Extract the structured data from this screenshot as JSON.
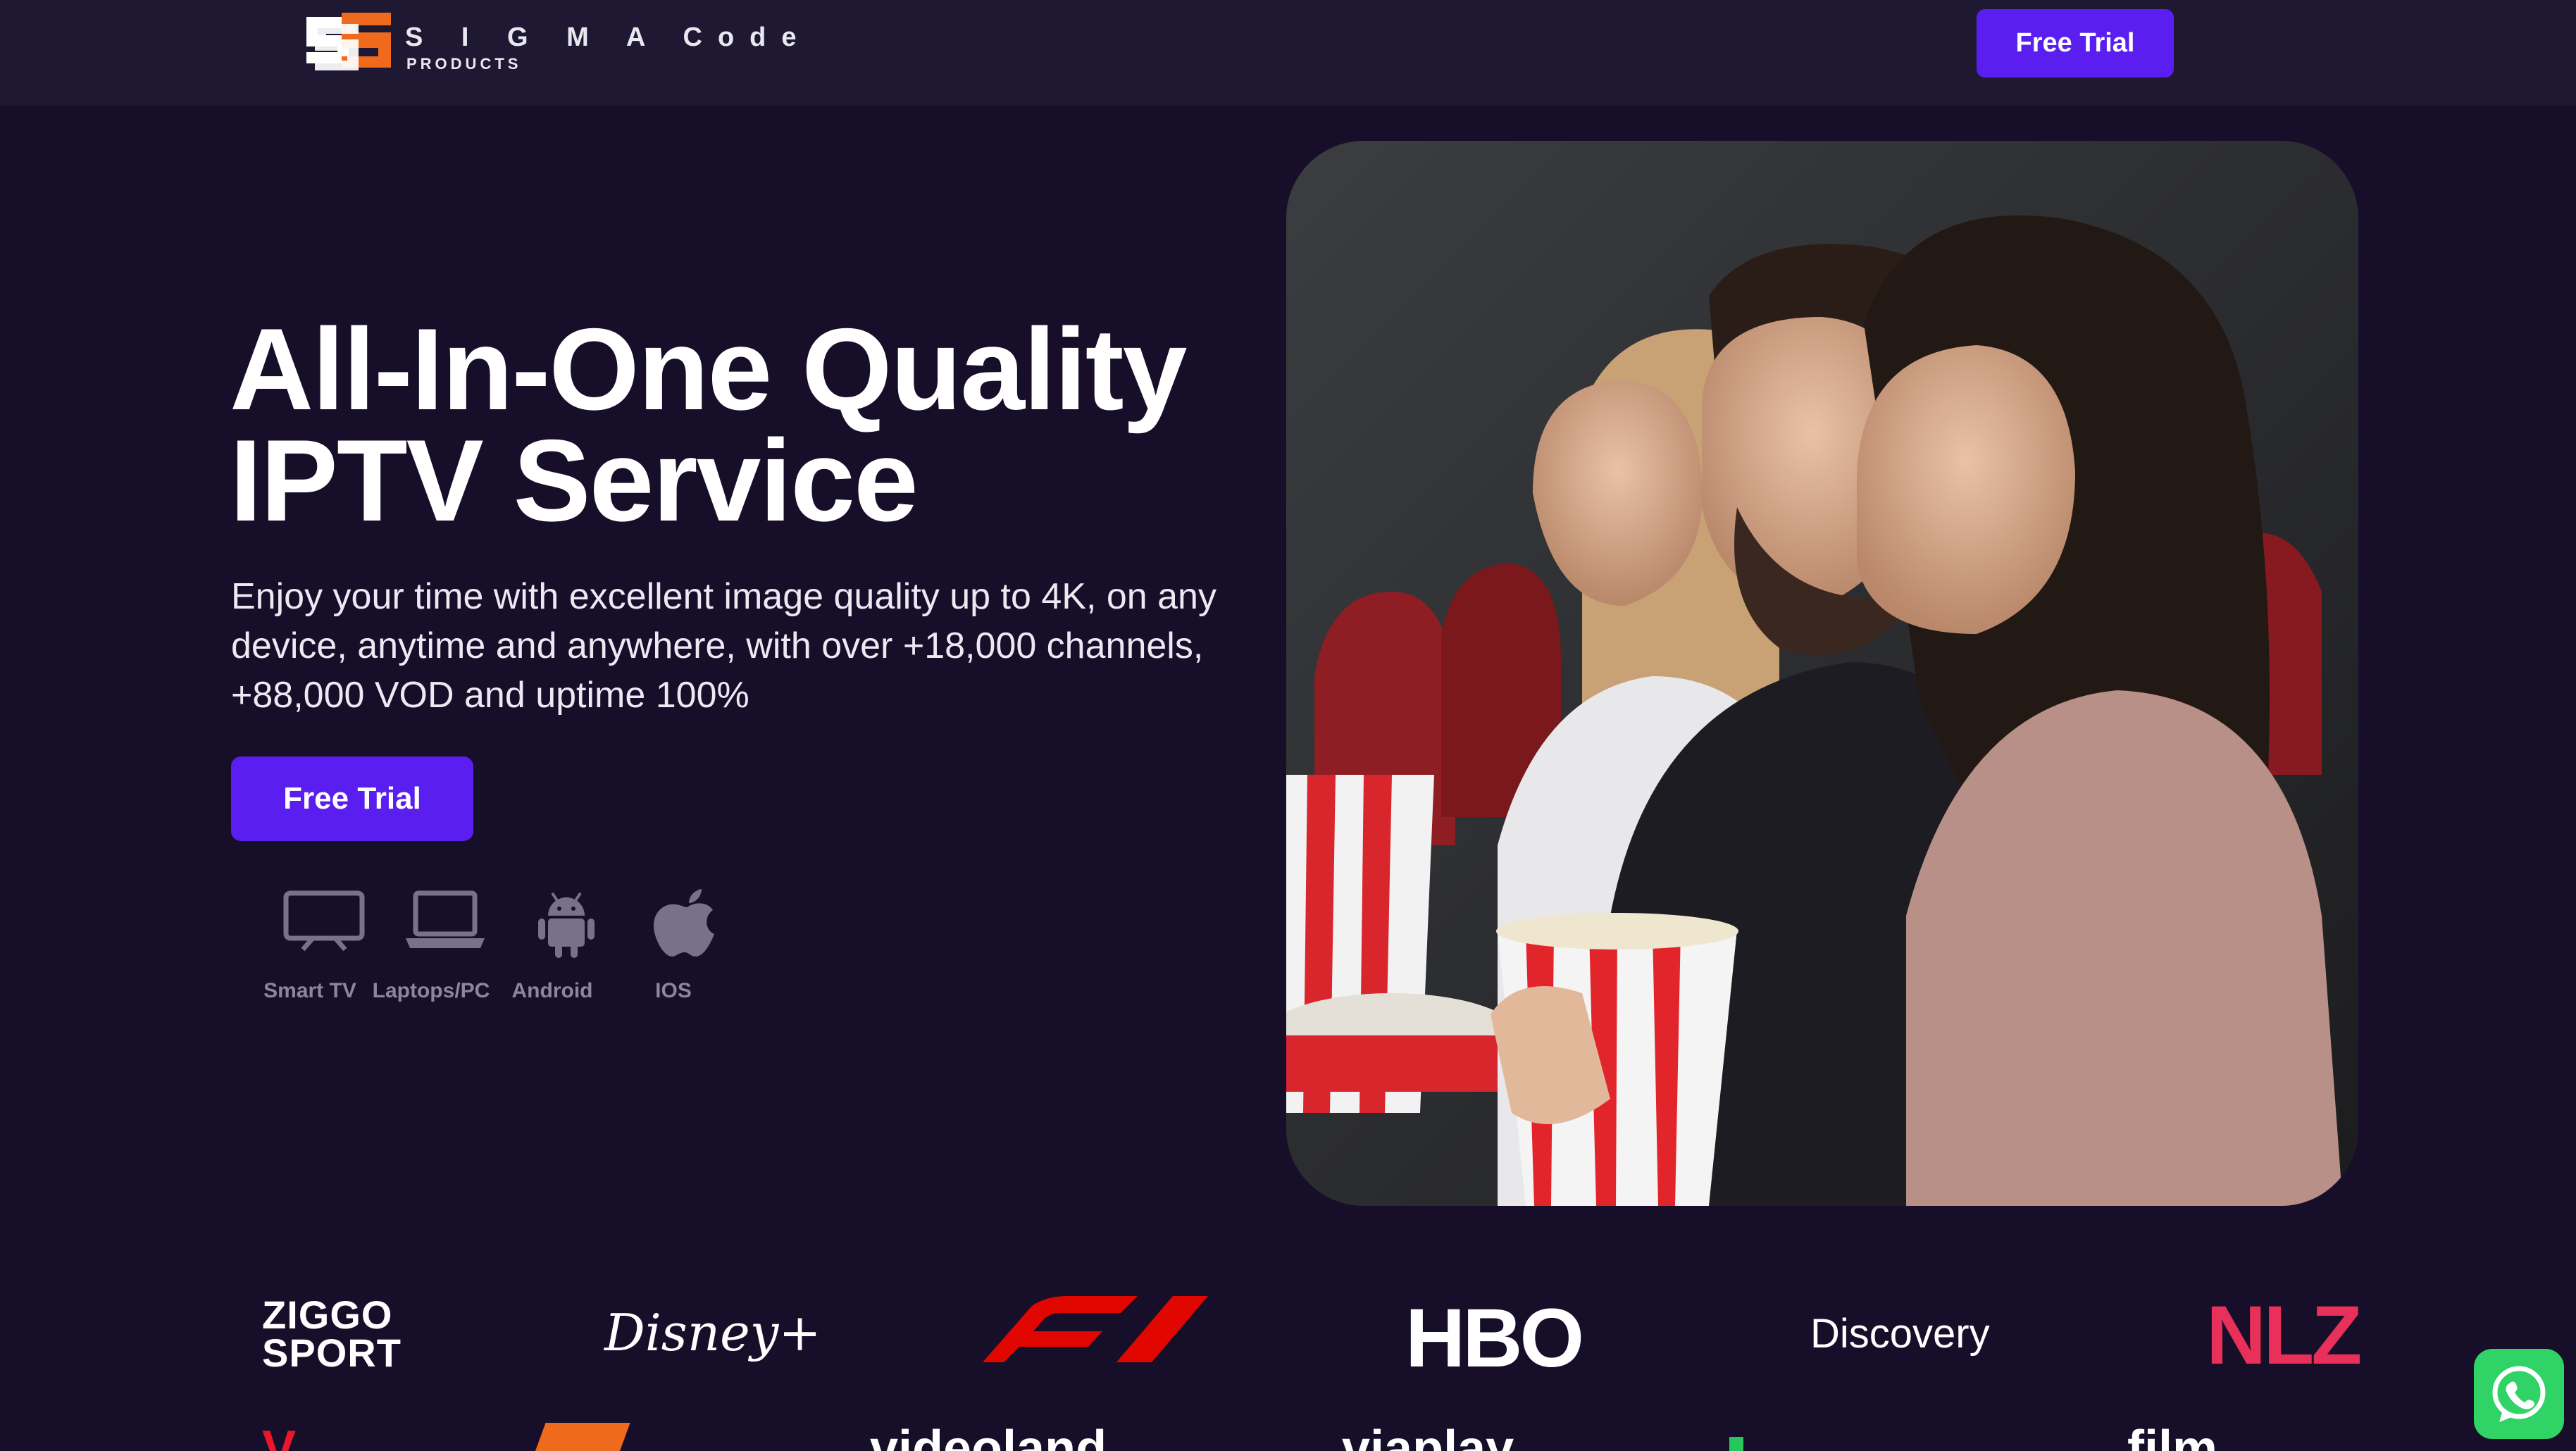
{
  "header": {
    "logo_brand": "S I G M A Code",
    "logo_sub": "PRODUCTS",
    "free_trial_label": "Free Trial"
  },
  "hero": {
    "headline_line1": "All-In-One Quality",
    "headline_line2": "IPTV Service",
    "subtext": "Enjoy your time with excellent image quality up to 4K, on any device, anytime and anywhere, with over +18,000 channels, +88,000 VOD and uptime 100%",
    "cta_label": "Free Trial"
  },
  "devices": [
    {
      "label": "Smart TV",
      "icon": "tv-icon"
    },
    {
      "label": "Laptops/PC",
      "icon": "laptop-icon"
    },
    {
      "label": "Android",
      "icon": "android-icon"
    },
    {
      "label": "IOS",
      "icon": "apple-icon"
    }
  ],
  "channels": {
    "row1": [
      "ZIGGO SPORT",
      "Disney+",
      "F1",
      "HBO",
      "Discovery",
      "NLZ"
    ],
    "ziggo_line1": "ZIGGO",
    "ziggo_line2": "SPORT",
    "disney": "Disney+",
    "hbo": "HBO",
    "discovery": "Discovery",
    "nlz": "NLZ",
    "row2_v": "V",
    "row2_videoland": "videoland",
    "row2_viaplay": "viaplay",
    "row2_film": "film"
  },
  "colors": {
    "background": "#170f29",
    "header": "#1f1833",
    "accent": "#5a1ff0",
    "logo_orange": "#f06a1d",
    "whatsapp": "#2fd366"
  }
}
